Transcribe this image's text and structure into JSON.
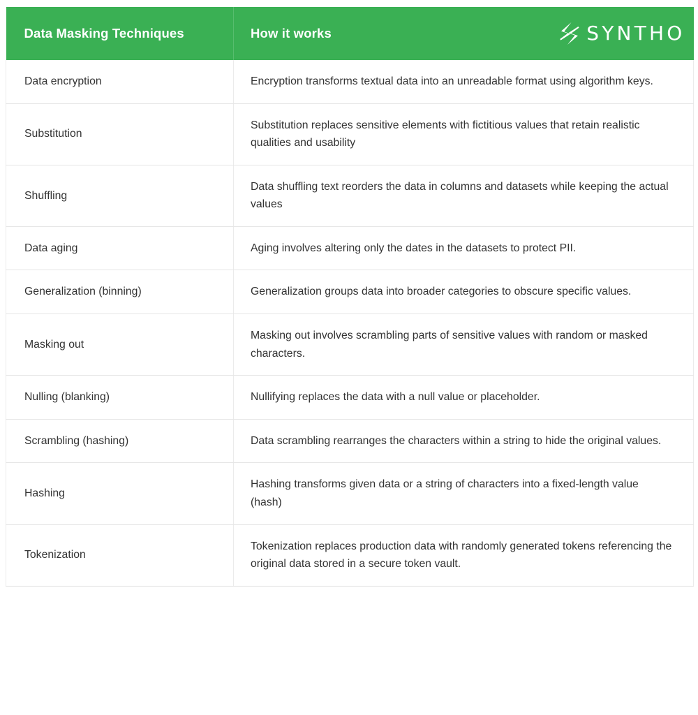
{
  "header": {
    "col_technique": "Data Masking Techniques",
    "col_how": "How it works",
    "logo_text": "SYNTHO",
    "logo_icon": "syntho-bolt-icon",
    "brand_color": "#3ab054",
    "header_text_color": "#ffffff"
  },
  "table": {
    "columns": [
      "Data Masking Techniques",
      "How it works"
    ],
    "rows": [
      {
        "technique": "Data encryption",
        "how": "Encryption transforms textual data into an unreadable format using algorithm keys."
      },
      {
        "technique": "Substitution",
        "how": "Substitution replaces sensitive elements with fictitious values that retain realistic qualities and usability"
      },
      {
        "technique": "Shuffling",
        "how": "Data shuffling text reorders the data in columns and datasets while keeping the actual values"
      },
      {
        "technique": "Data aging",
        "how": "Aging involves altering only the dates in the datasets to protect PII."
      },
      {
        "technique": "Generalization (binning)",
        "how": "Generalization groups data into broader categories to obscure specific values."
      },
      {
        "technique": "Masking out",
        "how": "Masking out involves scrambling parts of sensitive values with random or masked characters."
      },
      {
        "technique": "Nulling (blanking)",
        "how": "Nullifying replaces the data with a null value or placeholder."
      },
      {
        "technique": "Scrambling (hashing)",
        "how": "Data scrambling rearranges the characters within a string to hide the original values."
      },
      {
        "technique": "Hashing",
        "how": "Hashing transforms given data or a string of characters into a fixed-length value (hash)"
      },
      {
        "technique": "Tokenization",
        "how": "Tokenization replaces production data with randomly generated tokens referencing the original data stored in a secure token vault."
      }
    ]
  }
}
